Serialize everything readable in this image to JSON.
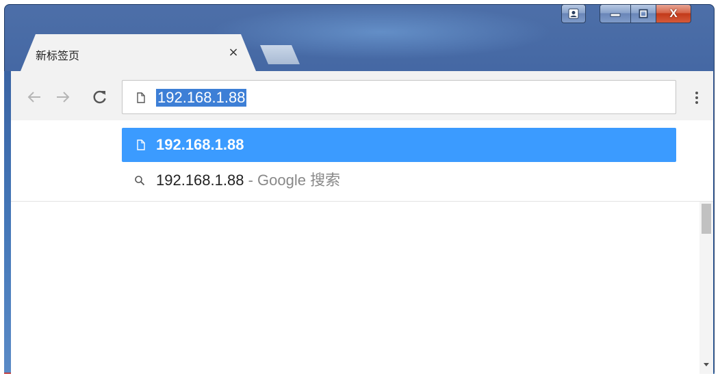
{
  "window": {
    "controls": {
      "user_icon": "user-icon",
      "minimize_icon": "minimize-icon",
      "maximize_icon": "maximize-icon",
      "close_label": "X"
    },
    "frame_color": "#3f63a1"
  },
  "tabs": [
    {
      "title": "新标签页",
      "close_label": "×",
      "active": true
    }
  ],
  "toolbar": {
    "back_icon": "arrow-left-icon",
    "forward_icon": "arrow-right-icon",
    "reload_label": "C",
    "menu_icon": "vertical-dots-icon"
  },
  "omnibox": {
    "page_icon": "page-icon",
    "value": "192.168.1.88",
    "selected": true,
    "selection_color": "#3d7fd6"
  },
  "suggestions": [
    {
      "icon": "page-icon",
      "text": "192.168.1.88",
      "selected": true,
      "highlight_color": "#3b9bff"
    },
    {
      "icon": "search-icon",
      "text": "192.168.1.88",
      "suffix": " - Google 搜索",
      "selected": false
    }
  ],
  "scrollbar": {
    "down_icon": "scroll-down-arrow-icon"
  }
}
